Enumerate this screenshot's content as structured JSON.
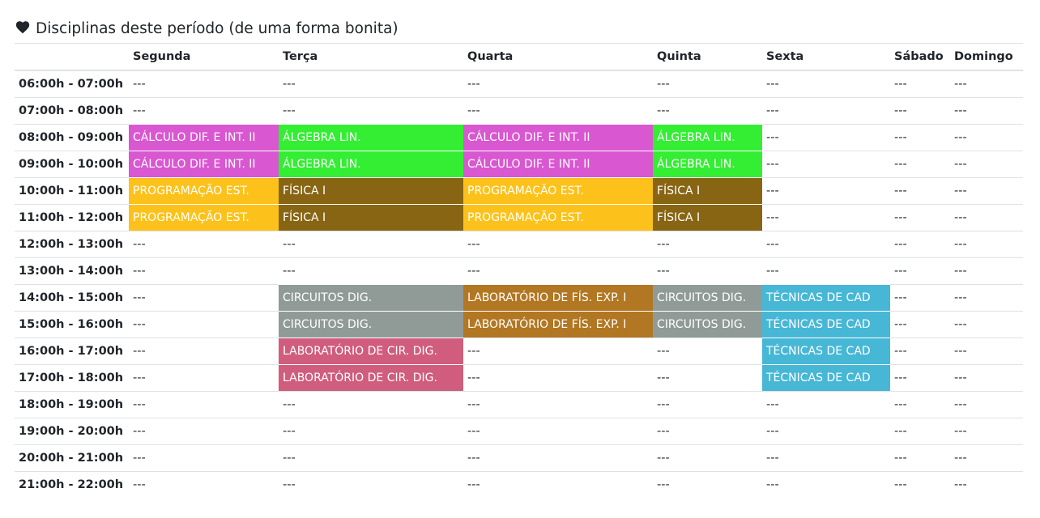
{
  "title": "Disciplinas deste período (de uma forma bonita)",
  "icons": {
    "title_icon": "heart-icon"
  },
  "days": [
    "Segunda",
    "Terça",
    "Quarta",
    "Quinta",
    "Sexta",
    "Sábado",
    "Domingo"
  ],
  "empty_text": "---",
  "courses": {
    "calc": {
      "name": "CÁLCULO DIF. E INT. II",
      "color": "#d957d1"
    },
    "alg": {
      "name": "ÁLGEBRA LIN.",
      "color": "#33ee33"
    },
    "prog": {
      "name": "PROGRAMAÇÃO EST.",
      "color": "#fcc21b"
    },
    "fis": {
      "name": "FÍSICA I",
      "color": "#876513"
    },
    "circ": {
      "name": "CIRCUITOS DIG.",
      "color": "#909b98"
    },
    "labfis": {
      "name": "LABORATÓRIO DE FÍS. EXP. I",
      "color": "#b27722"
    },
    "cad": {
      "name": "TÉCNICAS DE CAD",
      "color": "#47b7d6"
    },
    "labcir": {
      "name": "LABORATÓRIO DE CIR. DIG.",
      "color": "#d05d7d"
    }
  },
  "rows": [
    {
      "time": "06:00h - 07:00h",
      "cells": [
        null,
        null,
        null,
        null,
        null,
        null,
        null
      ]
    },
    {
      "time": "07:00h - 08:00h",
      "cells": [
        null,
        null,
        null,
        null,
        null,
        null,
        null
      ]
    },
    {
      "time": "08:00h - 09:00h",
      "cells": [
        "calc",
        "alg",
        "calc",
        "alg",
        null,
        null,
        null
      ]
    },
    {
      "time": "09:00h - 10:00h",
      "cells": [
        "calc",
        "alg",
        "calc",
        "alg",
        null,
        null,
        null
      ]
    },
    {
      "time": "10:00h - 11:00h",
      "cells": [
        "prog",
        "fis",
        "prog",
        "fis",
        null,
        null,
        null
      ]
    },
    {
      "time": "11:00h - 12:00h",
      "cells": [
        "prog",
        "fis",
        "prog",
        "fis",
        null,
        null,
        null
      ]
    },
    {
      "time": "12:00h - 13:00h",
      "cells": [
        null,
        null,
        null,
        null,
        null,
        null,
        null
      ]
    },
    {
      "time": "13:00h - 14:00h",
      "cells": [
        null,
        null,
        null,
        null,
        null,
        null,
        null
      ]
    },
    {
      "time": "14:00h - 15:00h",
      "cells": [
        null,
        "circ",
        "labfis",
        "circ",
        "cad",
        null,
        null
      ]
    },
    {
      "time": "15:00h - 16:00h",
      "cells": [
        null,
        "circ",
        "labfis",
        "circ",
        "cad",
        null,
        null
      ]
    },
    {
      "time": "16:00h - 17:00h",
      "cells": [
        null,
        "labcir",
        null,
        null,
        "cad",
        null,
        null
      ]
    },
    {
      "time": "17:00h - 18:00h",
      "cells": [
        null,
        "labcir",
        null,
        null,
        "cad",
        null,
        null
      ]
    },
    {
      "time": "18:00h - 19:00h",
      "cells": [
        null,
        null,
        null,
        null,
        null,
        null,
        null
      ]
    },
    {
      "time": "19:00h - 20:00h",
      "cells": [
        null,
        null,
        null,
        null,
        null,
        null,
        null
      ]
    },
    {
      "time": "20:00h - 21:00h",
      "cells": [
        null,
        null,
        null,
        null,
        null,
        null,
        null
      ]
    },
    {
      "time": "21:00h - 22:00h",
      "cells": [
        null,
        null,
        null,
        null,
        null,
        null,
        null
      ]
    }
  ]
}
